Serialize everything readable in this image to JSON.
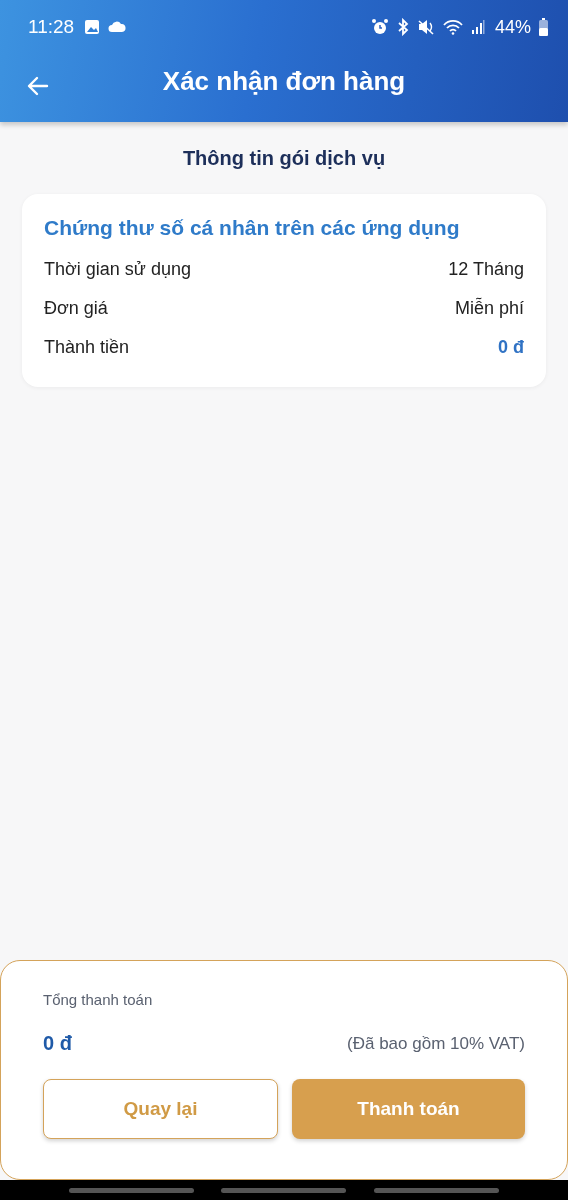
{
  "status_bar": {
    "time": "11:28",
    "battery": "44%"
  },
  "header": {
    "title": "Xác nhận đơn hàng"
  },
  "section_title": "Thông tin gói dịch vụ",
  "package": {
    "name": "Chứng thư số cá nhân trên các ứng dụng",
    "rows": [
      {
        "label": "Thời gian sử dụng",
        "value": "12 Tháng",
        "kind": "plain"
      },
      {
        "label": "Đơn giá",
        "value": "Miễn phí",
        "kind": "plain"
      },
      {
        "label": "Thành tiền",
        "value": "0 đ",
        "kind": "total"
      }
    ]
  },
  "footer": {
    "total_label": "Tổng thanh toán",
    "total_value": "0 đ",
    "vat_note": "(Đã bao gồm 10% VAT)",
    "buttons": [
      {
        "label": "Quay lại",
        "kind": "outline"
      },
      {
        "label": "Thanh toán",
        "kind": "filled"
      }
    ]
  }
}
